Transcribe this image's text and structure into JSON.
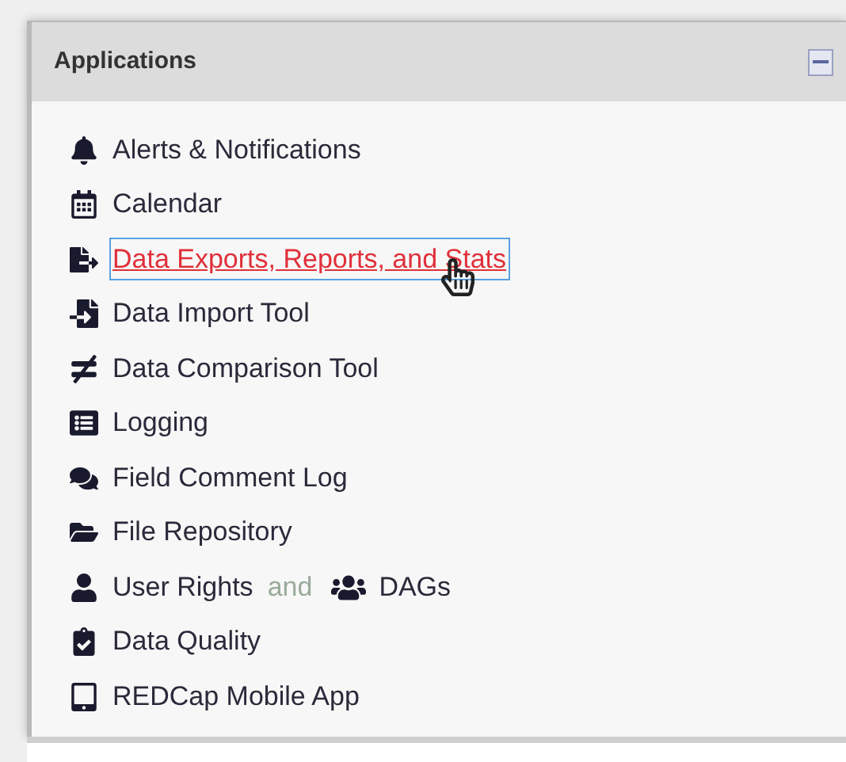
{
  "panel": {
    "title": "Applications",
    "collapsed": false,
    "items": [
      {
        "label": "Alerts & Notifications",
        "focused": false
      },
      {
        "label": "Calendar",
        "focused": false
      },
      {
        "label": "Data Exports, Reports, and Stats",
        "focused": true
      },
      {
        "label": "Data Import Tool",
        "focused": false
      },
      {
        "label": "Data Comparison Tool",
        "focused": false
      },
      {
        "label": "Logging",
        "focused": false
      },
      {
        "label": "Field Comment Log",
        "focused": false
      },
      {
        "label": "File Repository",
        "focused": false
      },
      {
        "label": "User Rights",
        "focused": false,
        "connector": "and",
        "extra": {
          "label": "DAGs"
        }
      },
      {
        "label": "Data Quality",
        "focused": false
      },
      {
        "label": "REDCap Mobile App",
        "focused": false
      }
    ]
  }
}
